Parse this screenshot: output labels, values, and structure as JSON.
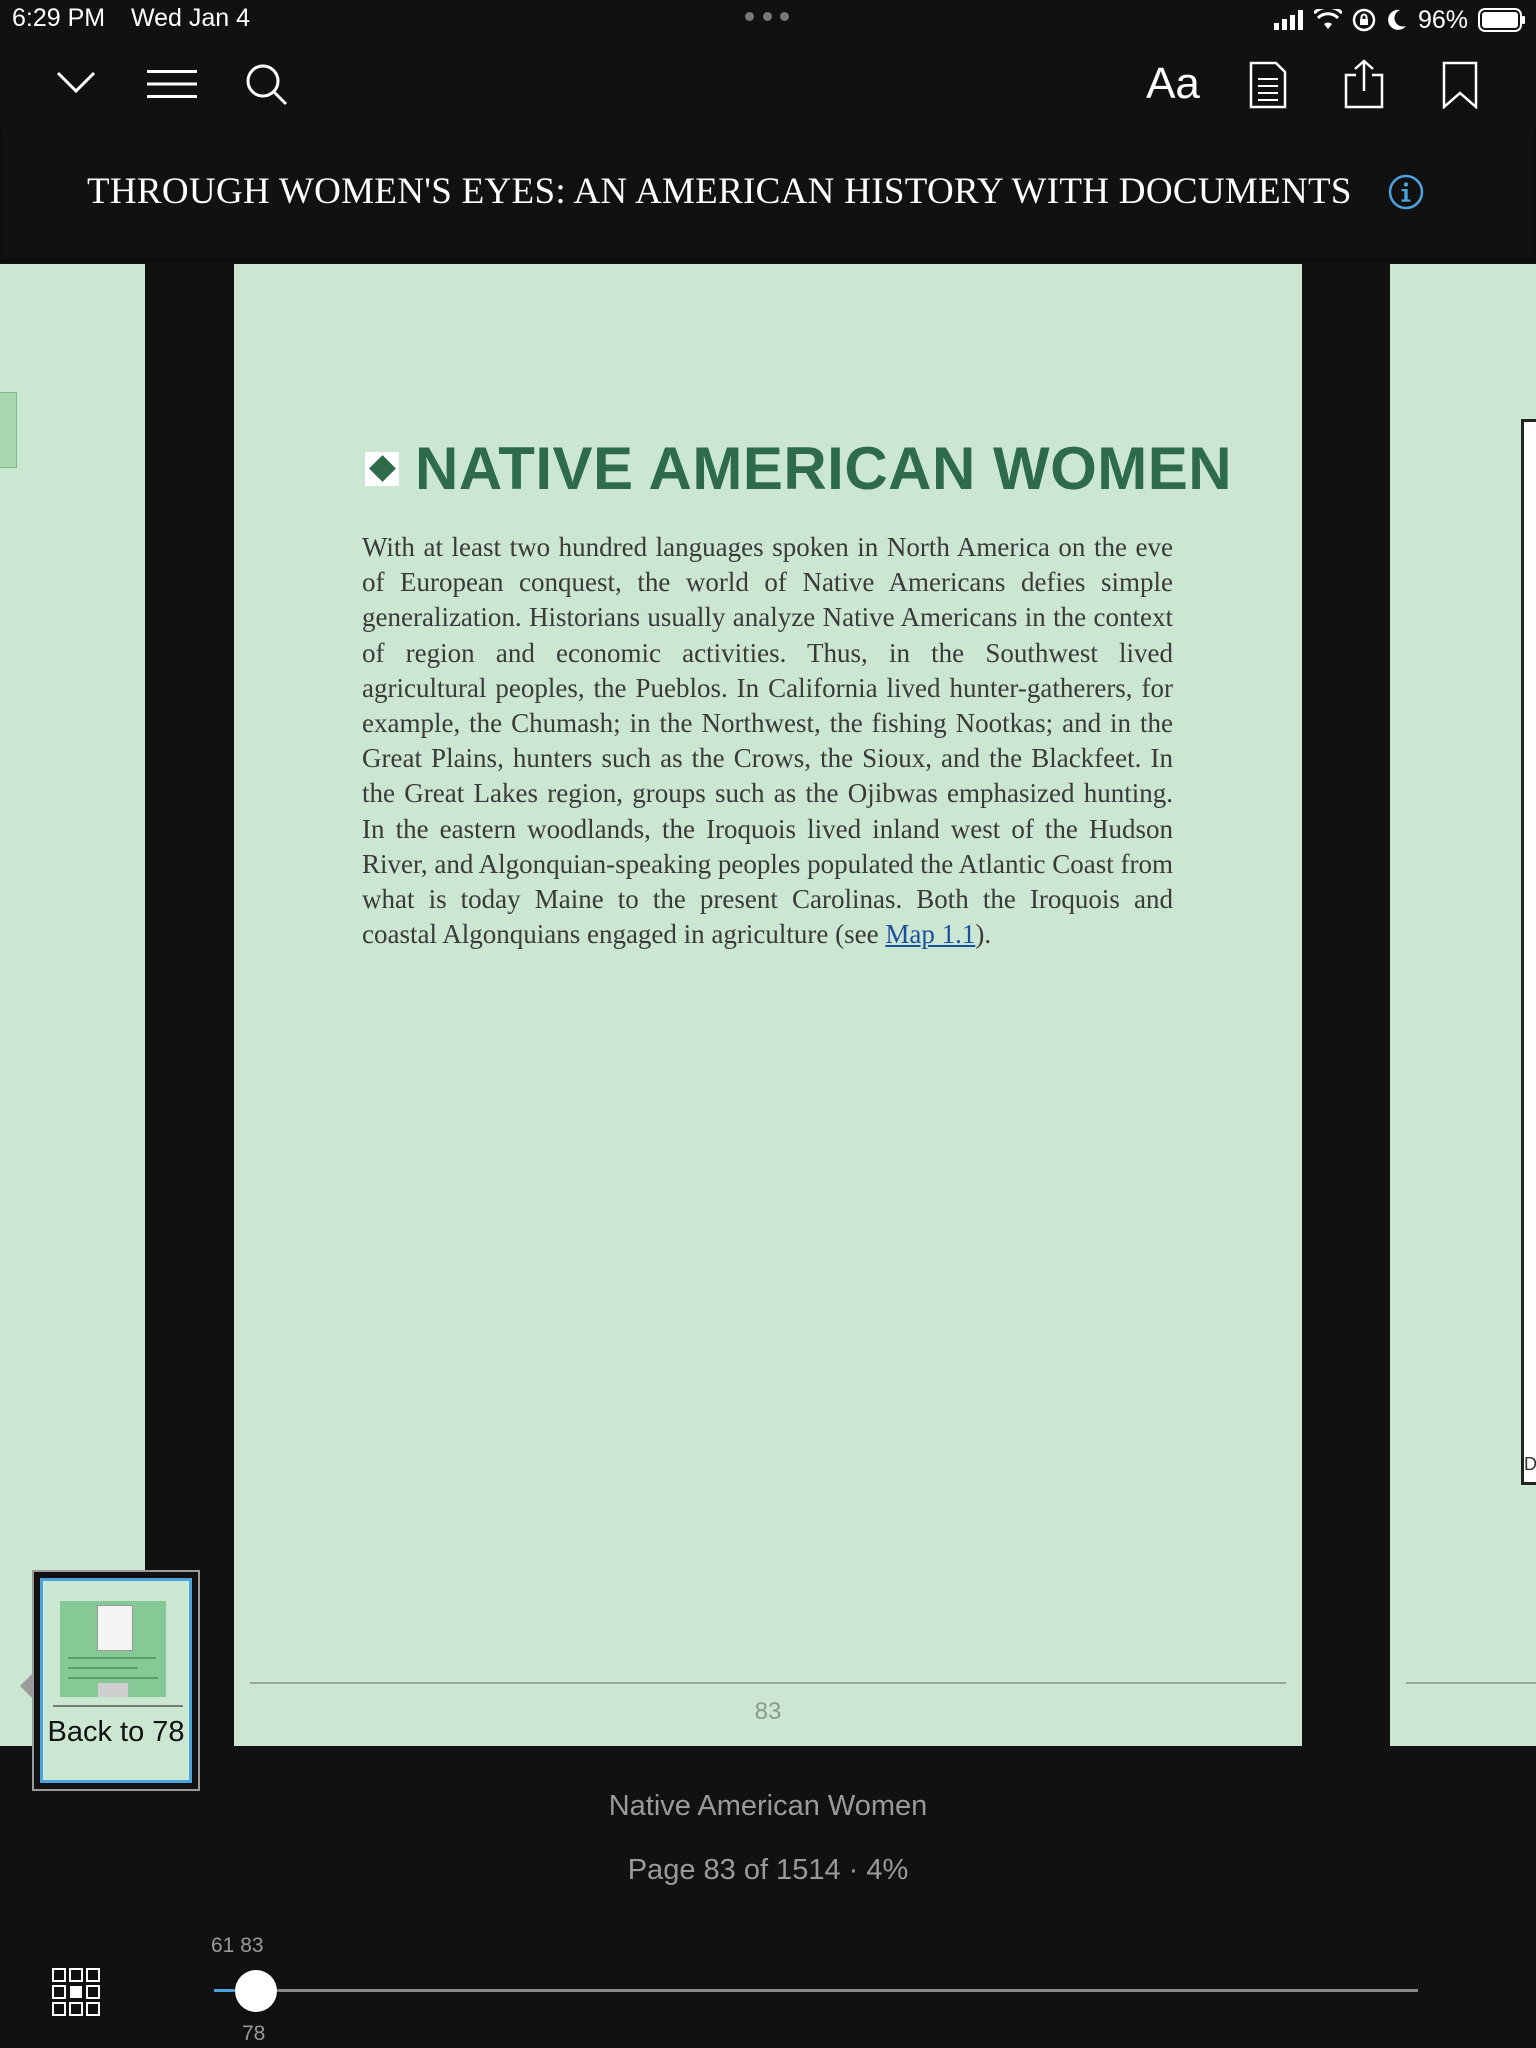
{
  "status_bar": {
    "time": "6:29 PM",
    "date": "Wed Jan 4",
    "battery": "96%"
  },
  "toolbar": {
    "collapse_icon": "chevron-down-icon",
    "menu_icon": "hamburger-icon",
    "search_icon": "search-icon",
    "font_settings_label": "Aa",
    "notes_icon": "document-icon",
    "share_icon": "share-icon",
    "bookmark_icon": "bookmark-icon"
  },
  "header": {
    "book_title": "THROUGH WOMEN'S EYES: AN AMERICAN HISTORY WITH DOCUMENTS",
    "info_icon": "info-icon"
  },
  "page": {
    "heading": "NATIVE AMERICAN WOMEN",
    "body_before_link": "With at least two hundred languages spoken in North America on the eve of European conquest, the world of Native Americans defies simple generalization. Historians usually analyze Native Americans in the context of region and economic activities. Thus, in the Southwest lived agricultural peoples, the Pueblos. In California lived hunter-gatherers, for example, the Chumash; in the Northwest, the fishing Nootkas; and in the Great Plains, hunters such as the Crows, the Sioux, and the Blackfeet. In the Great Lakes region, groups such as the Ojibwas emphasized hunting. In the eastern woodlands, the Iroquois lived inland west of the Hudson River, and Algonquian-speaking peoples populated the Atlantic Coast from what is today Maine to the present Carolinas. Both the Iroquois and coastal Algonquians engaged in agriculture (see ",
    "link_text": "Map 1.1",
    "body_after_link": ").",
    "page_number": "83",
    "accent_color": "#2d6b4b",
    "page_color": "#cbe6d1"
  },
  "right_page": {
    "fragment": "D"
  },
  "back_popup": {
    "label": "Back to 78"
  },
  "footer": {
    "chapter": "Native American Women",
    "status": "Page 83 of 1514 · 4%"
  },
  "slider": {
    "top_labels": "61 83",
    "bottom_label": "78",
    "progress_fraction": 0.04,
    "accent_color": "#4aa3dc"
  },
  "page_grid_icon": "grid-icon"
}
